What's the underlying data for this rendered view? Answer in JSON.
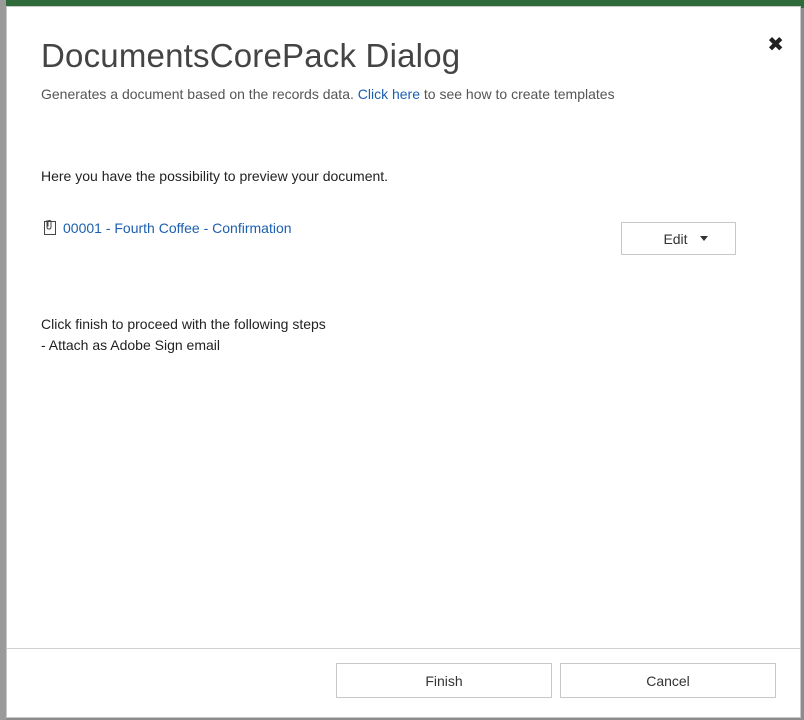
{
  "dialog": {
    "title": "DocumentsCorePack Dialog",
    "subtitle_prefix": "Generates a document based on the records data. ",
    "subtitle_link": "Click here",
    "subtitle_suffix": " to see how to create templates",
    "intro": "Here you have the possibility to preview your document.",
    "document": {
      "name": "00001 - Fourth Coffee - Confirmation",
      "icon": "paperclip-icon"
    },
    "edit_button": {
      "label": "Edit",
      "icon": "caret-down-icon"
    },
    "steps_line1": "Click finish to proceed with the following steps",
    "steps_line2": "- Attach as Adobe Sign email",
    "close_icon": "close-icon"
  },
  "footer": {
    "finish_label": "Finish",
    "cancel_label": "Cancel"
  },
  "colors": {
    "link": "#1c5fb0",
    "title": "#444444",
    "border": "#c8c8c8"
  }
}
